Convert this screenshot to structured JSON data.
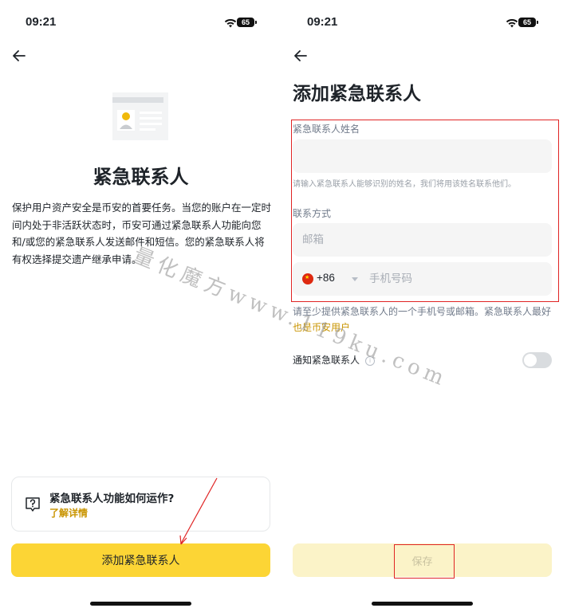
{
  "status_bar": {
    "time": "09:21",
    "battery": "65"
  },
  "left_screen": {
    "title": "紧急联系人",
    "description": "保护用户资产安全是币安的首要任务。当您的账户在一定时间内处于非活跃状态时，币安可通过紧急联系人功能向您和/或您的紧急联系人发送邮件和短信。您的紧急联系人将有权选择提交遗产继承申请。",
    "info_card": {
      "title": "紧急联系人功能如何运作?",
      "link": "了解详情",
      "icon": "question-bubble-icon"
    },
    "add_button": "添加紧急联系人"
  },
  "right_screen": {
    "title": "添加紧急联系人",
    "name_field": {
      "label": "紧急联系人姓名",
      "value": "",
      "hint": "请输入紧急联系人能够识别的姓名，我们将用该姓名联系他们。"
    },
    "contact_section": {
      "label": "联系方式",
      "email_placeholder": "邮箱",
      "country_code": "+86",
      "country_flag": "china-flag-icon",
      "phone_placeholder": "手机号码"
    },
    "note": {
      "text": "请至少提供紧急联系人的一个手机号或邮箱。紧急联系人最好",
      "link": "也是币安用户"
    },
    "notify": {
      "label": "通知紧急联系人",
      "enabled": false
    },
    "save_button": "保存"
  },
  "watermark": "量化魔方www.119ku.com",
  "colors": {
    "accent": "#fcd535",
    "link": "#c99400",
    "annotation": "#e02424",
    "input_bg": "#f5f5f5"
  }
}
